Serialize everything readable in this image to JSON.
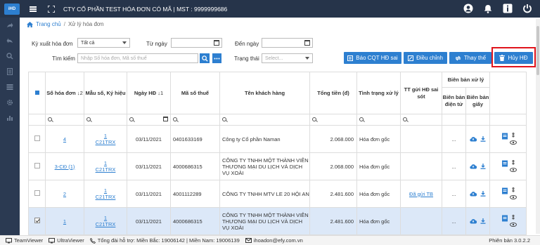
{
  "topbar": {
    "logo": "iHD",
    "company": "CTY CỔ PHẦN TEST HÓA ĐƠN CÓ MÃ | MST : 9999999686"
  },
  "breadcrumb": {
    "home": "Trang chủ",
    "sep": "/",
    "current": "Xử lý hóa đơn"
  },
  "filters": {
    "ky_xuat_label": "Kỳ xuất hóa đơn",
    "ky_xuat_value": "Tất cả",
    "tu_ngay_label": "Từ ngày",
    "den_ngay_label": "Đến ngày",
    "tim_kiem_label": "Tìm kiếm",
    "tim_kiem_placeholder": "Nhập Số hóa đơn, Mã số thuế",
    "trang_thai_label": "Trạng thái",
    "trang_thai_placeholder": "Select..."
  },
  "buttons": {
    "bao_cqt": "Báo CQT HĐ sai",
    "dieu_chinh": "Điều chỉnh",
    "thay_the": "Thay thế",
    "huy_hd": "Hủy HĐ"
  },
  "table": {
    "headers": {
      "so_hd": "Số hóa đơn",
      "so_hd_sort": "↓2",
      "mau_so": "Mẫu số, Ký hiệu",
      "ngay_hd": "Ngày HĐ",
      "ngay_hd_sort": "↓1",
      "mst": "Mã số thuế",
      "ten_kh": "Tên khách hàng",
      "tong_tien": "Tổng tiền (đ)",
      "tinh_trang": "Tình trạng xử lý",
      "tt_gui": "TT gửi HĐ sai sót",
      "bien_ban": "Biên bản xử lý",
      "bb_dien_tu": "Biên bản điện tử",
      "bb_giay": "Biên bản giấy"
    },
    "rows": [
      {
        "so_hd": "4",
        "mau_so_1": "1",
        "mau_so_2": "C21TRX",
        "ngay": "03/11/2021",
        "mst": "0401633169",
        "ten": "Công ty Cổ phần Naman",
        "tong": "2.068.000",
        "tinh_trang": "Hóa đơn gốc",
        "tt_gui": "",
        "dien_tu": "...",
        "giay": ""
      },
      {
        "so_hd": "3-CĐ (1)",
        "mau_so_1": "1",
        "mau_so_2": "C21TRX",
        "ngay": "03/11/2021",
        "mst": "4000686315",
        "ten": "CÔNG TY TNHH MỘT THÀNH VIÊN THƯƠNG MẠI DU LỊCH VÀ DỊCH VỤ XOÀI",
        "tong": "2.068.000",
        "tinh_trang": "Hóa đơn gốc",
        "tt_gui": "",
        "dien_tu": "...",
        "giay": ""
      },
      {
        "so_hd": "2",
        "mau_so_1": "1",
        "mau_so_2": "C21TRX",
        "ngay": "03/11/2021",
        "mst": "4001112289",
        "ten": "CÔNG TY TNHH MTV LE 20 HỘI AN",
        "tong": "2.481.600",
        "tinh_trang": "Hóa đơn gốc",
        "tt_gui": "Đã gửi TB",
        "dien_tu": "...",
        "giay": ""
      },
      {
        "so_hd": "1",
        "mau_so_1": "1",
        "mau_so_2": "C21TRX",
        "ngay": "03/11/2021",
        "mst": "4000686315",
        "ten": "CÔNG TY TNHH MỘT THÀNH VIÊN THƯƠNG MẠI DU LỊCH VÀ DỊCH VỤ XOÀI",
        "tong": "2.481.600",
        "tinh_trang": "Hóa đơn gốc",
        "tt_gui": "",
        "dien_tu": "...",
        "giay": ""
      }
    ]
  },
  "footer": {
    "teamviewer": "TeamViewer",
    "ultraviewer": "UltraViewer",
    "hotline": "Tổng đài hỗ trợ: Miền Bắc: 19006142 | Miền Nam: 19006139",
    "email": "ihoadon@efy.com.vn",
    "version": "Phiên bản 3.0.2.2"
  },
  "colors": {
    "topbar": "#26344a",
    "primary": "#2d7fd0",
    "highlight": "#e0141c"
  }
}
